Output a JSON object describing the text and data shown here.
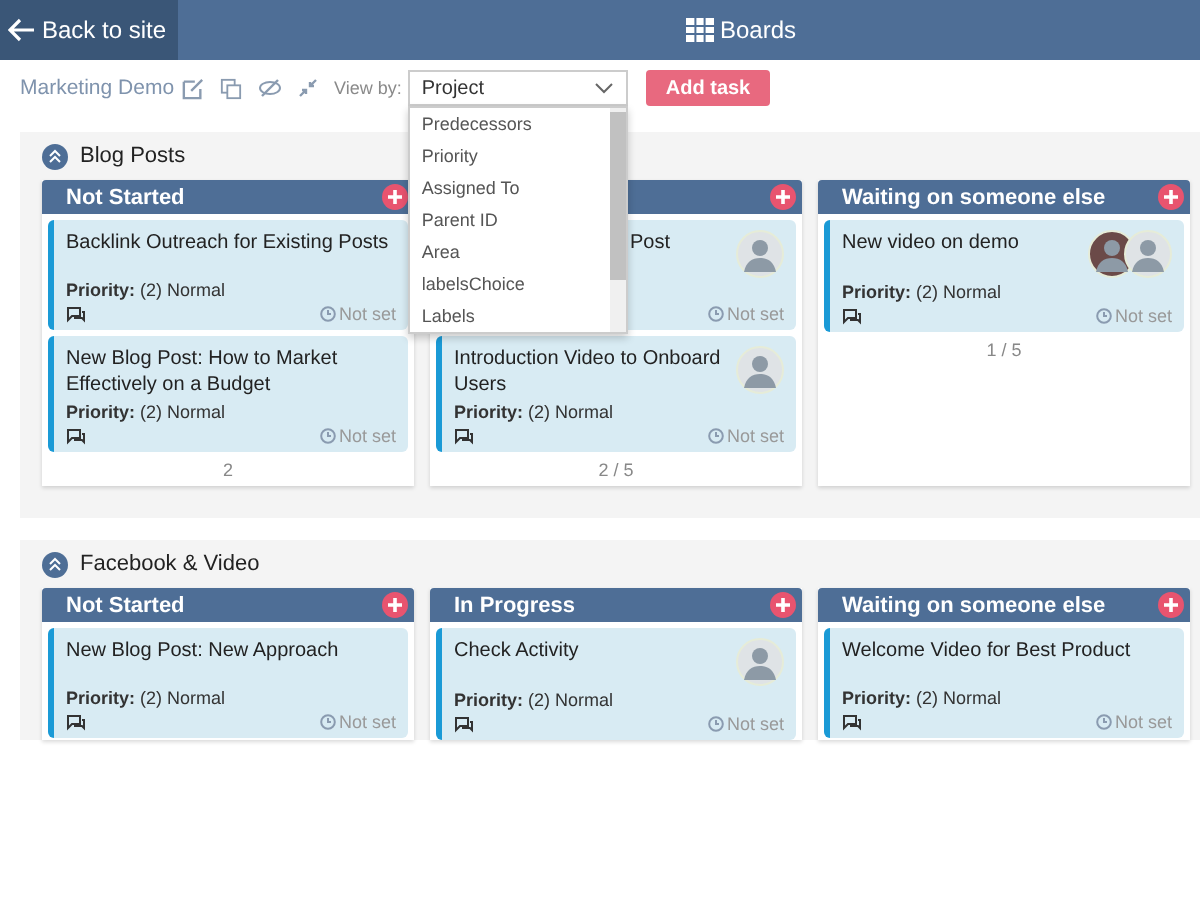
{
  "topbar": {
    "back": "Back to site",
    "title": "Boards"
  },
  "toolbar": {
    "board_name": "Marketing Demo",
    "view_label": "View by:",
    "view_value": "Project",
    "add_button": "Add task",
    "dropdown": {
      "expanded": true,
      "options": [
        "Predecessors",
        "Priority",
        "Assigned To",
        "Parent ID",
        "Area",
        "labelsChoice",
        "Labels"
      ]
    }
  },
  "sections": [
    {
      "title": "Blog Posts",
      "columns": [
        {
          "title": "Not Started",
          "footer": "2",
          "cards": [
            {
              "kind": "full",
              "title": "Backlink Outreach for Existing Posts",
              "priority_label": "Priority:",
              "priority": "(2) Normal",
              "due": "Not set"
            },
            {
              "kind": "full",
              "title": "New Blog Post: How to Market Effectively on a Budget",
              "priority_label": "Priority:",
              "priority": "(2) Normal",
              "due": "Not set"
            }
          ]
        },
        {
          "footer": "2 / 5",
          "cards": [
            {
              "kind": "covered",
              "title": "Post",
              "due": "Not set",
              "avatars": [
                {
                  "kind": "photo"
                }
              ]
            },
            {
              "kind": "full",
              "title": "Introduction Video to Onboard Users",
              "priority_label": "Priority:",
              "priority": "(2) Normal",
              "due": "Not set",
              "avatars": [
                {
                  "kind": "photo"
                }
              ]
            }
          ]
        },
        {
          "title": "Waiting on someone else",
          "footer": "1 / 5",
          "cards": [
            {
              "kind": "full",
              "title": "New video on demo",
              "priority_label": "Priority:",
              "priority": "(2) Normal",
              "due": "Not set",
              "avatars": [
                {
                  "kind": "photo"
                },
                {
                  "kind": "photo"
                }
              ]
            }
          ]
        }
      ]
    },
    {
      "title": "Facebook & Video",
      "columns": [
        {
          "title": "Not Started",
          "cards": [
            {
              "kind": "full",
              "title": "New Blog Post: New Approach",
              "priority_label": "Priority:",
              "priority": "(2) Normal",
              "due": "Not set"
            }
          ]
        },
        {
          "title": "In Progress",
          "cards": [
            {
              "kind": "full",
              "title": "Check Activity",
              "priority_label": "Priority:",
              "priority": "(2) Normal",
              "due": "Not set",
              "avatars": [
                {
                  "kind": "photo"
                }
              ]
            }
          ]
        },
        {
          "title": "Waiting on someone else",
          "cards": [
            {
              "kind": "full",
              "title": "Welcome Video for Best Product",
              "priority_label": "Priority:",
              "priority": "(2) Normal",
              "due": "Not set"
            }
          ]
        }
      ]
    }
  ]
}
